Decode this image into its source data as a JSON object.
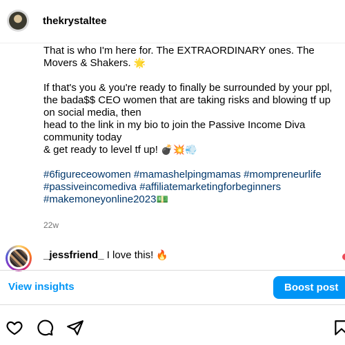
{
  "header": {
    "username": "thekrystaltee"
  },
  "caption": {
    "line1": "That is who I'm here for. The EXTRAORDINARY ones. The Movers & Shakers. ",
    "emoji1": "🌟",
    "line2": "If that's you & you're ready to finally be surrounded by your ppl, the bada$$ CEO women that are taking risks and blowing tf up on social media, then",
    "line3": "head to the link in my bio to join the Passive Income Diva community today",
    "line4": "& get ready to level tf up! ",
    "emoji2": "💣💥💨",
    "hashtags": "#6figureceowomen #mamashelpingmamas #mompreneurlife #passiveincomediva #affiliatemarketingforbeginners #makemoneyonline2023",
    "emoji3": "💵",
    "timestamp": "22w"
  },
  "comment": {
    "username": "_jessfriend_",
    "text": " I love this! ",
    "emoji": "🔥"
  },
  "actions": {
    "view_insights": "View insights",
    "boost_post": "Boost post"
  },
  "icons": {
    "like": "heart-icon",
    "comment": "comment-icon",
    "share": "share-icon",
    "save": "bookmark-icon"
  },
  "colors": {
    "link_blue": "#0095f6",
    "hashtag_blue": "#00376b",
    "muted_gray": "#737373"
  }
}
